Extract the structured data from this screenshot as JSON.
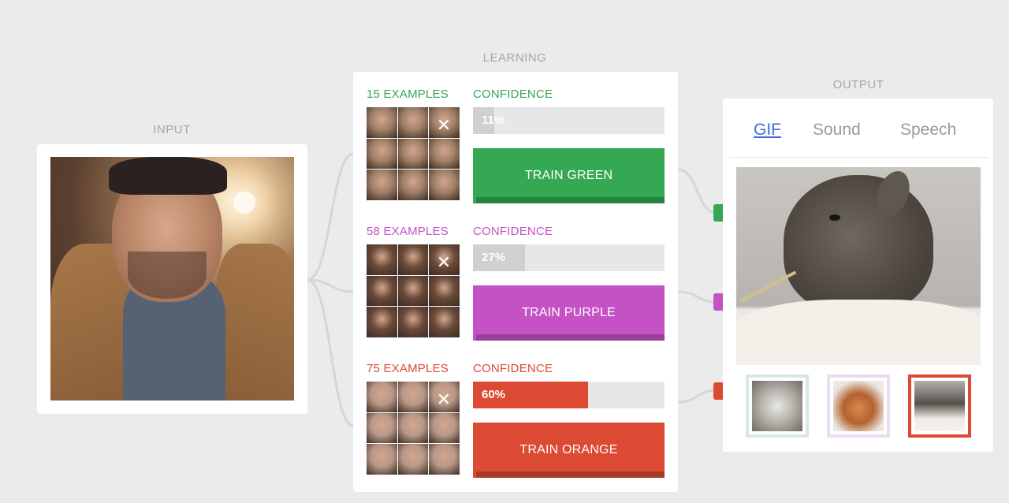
{
  "sections": {
    "input": "INPUT",
    "learning": "LEARNING",
    "output": "OUTPUT"
  },
  "colors": {
    "green": "#34a853",
    "purple": "#c552c5",
    "orange": "#dc4a33"
  },
  "classes": [
    {
      "key": "green",
      "examples": "15 EXAMPLES",
      "confidence_label": "CONFIDENCE",
      "confidence": 0.11,
      "confidence_text": "11%",
      "button": "TRAIN GREEN",
      "close_icon": "close-icon",
      "thumb_color": "#a08068"
    },
    {
      "key": "purple",
      "examples": "58 EXAMPLES",
      "confidence_label": "CONFIDENCE",
      "confidence": 0.27,
      "confidence_text": "27%",
      "button": "TRAIN PURPLE",
      "close_icon": "close-icon",
      "thumb_color": "#6a4a3a"
    },
    {
      "key": "orange",
      "examples": "75 EXAMPLES",
      "confidence_label": "CONFIDENCE",
      "confidence": 0.6,
      "confidence_text": "60%",
      "button": "TRAIN ORANGE",
      "close_icon": "close-icon",
      "thumb_color": "#b89888"
    }
  ],
  "output": {
    "tabs": [
      "GIF",
      "Sound",
      "Speech"
    ],
    "active_tab": "GIF",
    "gif_thumbs": [
      {
        "class": "green",
        "selected": false
      },
      {
        "class": "purple",
        "selected": false
      },
      {
        "class": "orange",
        "selected": true
      }
    ]
  }
}
